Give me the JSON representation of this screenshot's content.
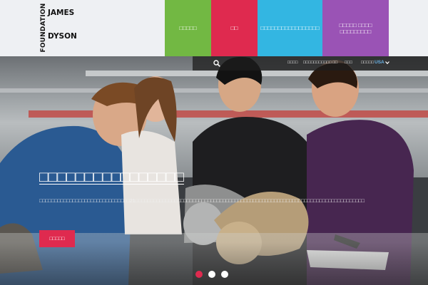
{
  "logo": {
    "vertical": "FOUNDATION",
    "line1": "JAMES",
    "line2": "DYSON"
  },
  "nav": [
    {
      "label": "□□□□□",
      "color": "#72b843"
    },
    {
      "label": "□□",
      "color": "#df2a4f"
    },
    {
      "label": "□□□□□□□□□□□□□□□□□",
      "color": "#33b6e2"
    },
    {
      "label": "□□□□□ □□□□ □□□□□□□□□",
      "color": "#9a53b5"
    }
  ],
  "utility": {
    "search_icon": "search-icon",
    "links": [
      "□□□□",
      "□□□□□□□□□□□",
      "□□",
      "□□□",
      "□□□□□"
    ],
    "country": "USA",
    "chevron_icon": "chevron-down-icon"
  },
  "hero": {
    "title": "□□□□□□□□□□□□□□□□",
    "description": "□□□□□□□□□□□□□□□□□□□□□□□□□□□□□□21□□□□□□□□□□□□□□□□□□□□□□□□□□□□□□□□□□□□□□□□□□□□□□□□□□□□□□□□□□□□□□□□□□□□□□□□□□□□",
    "button_label": "□□□□□",
    "accent": "#df2a4f"
  },
  "carousel": {
    "slides": 3,
    "active_index": 0
  }
}
